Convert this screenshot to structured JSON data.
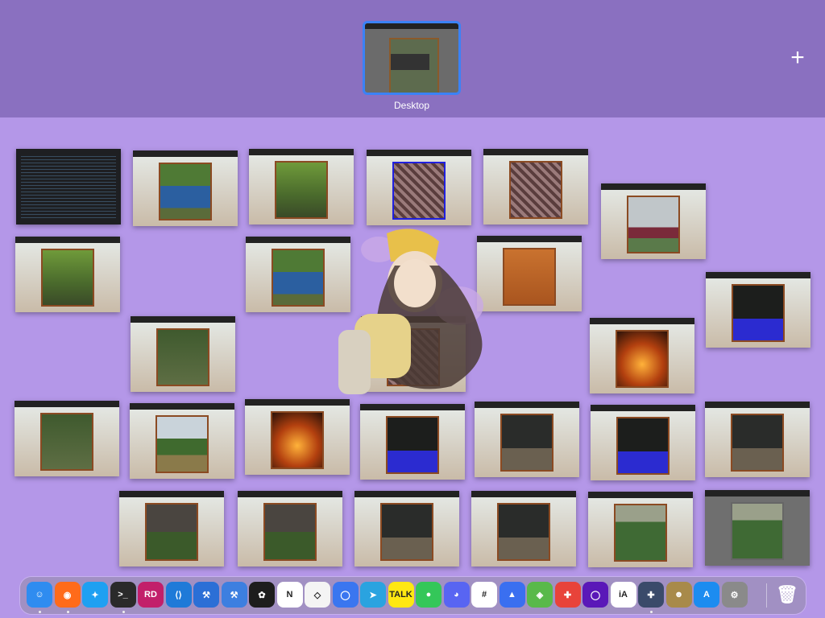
{
  "spaces": {
    "current_label": "Desktop",
    "add_symbol": "+"
  },
  "windows_count": 30,
  "dock": {
    "apps": [
      {
        "name": "Finder",
        "glyph": "☺",
        "color": "#2f8cf0",
        "running": true
      },
      {
        "name": "Firefox",
        "glyph": "◉",
        "color": "#ff6b1a",
        "running": true
      },
      {
        "name": "Safari",
        "glyph": "✦",
        "color": "#1ea0f2",
        "running": false
      },
      {
        "name": "Terminal Goat",
        "glyph": ">_",
        "color": "#2a2a2a",
        "running": true
      },
      {
        "name": "Rider",
        "glyph": "RD",
        "color": "#c21f6a",
        "running": false
      },
      {
        "name": "VS Code",
        "glyph": "⟨⟩",
        "color": "#1f7ad8",
        "running": false
      },
      {
        "name": "Xcode",
        "glyph": "⚒",
        "color": "#2b6fd6",
        "running": false
      },
      {
        "name": "Xcode Beta",
        "glyph": "⚒",
        "color": "#3d7fe0",
        "running": false
      },
      {
        "name": "Figma",
        "glyph": "✿",
        "color": "#1d1d1d",
        "running": false
      },
      {
        "name": "Notion",
        "glyph": "N",
        "color": "#ffffff",
        "running": false
      },
      {
        "name": "Unity",
        "glyph": "◇",
        "color": "#f4f4f4",
        "running": false
      },
      {
        "name": "Signal",
        "glyph": "◯",
        "color": "#3a76f0",
        "running": false
      },
      {
        "name": "Telegram",
        "glyph": "➤",
        "color": "#2aa3e0",
        "running": false
      },
      {
        "name": "KakaoTalk",
        "glyph": "TALK",
        "color": "#ffe812",
        "running": false
      },
      {
        "name": "Messages",
        "glyph": "●",
        "color": "#34c759",
        "running": false
      },
      {
        "name": "Discord",
        "glyph": "◕",
        "color": "#5865f2",
        "running": false
      },
      {
        "name": "Slack",
        "glyph": "#",
        "color": "#ffffff",
        "running": false
      },
      {
        "name": "Arc",
        "glyph": "▲",
        "color": "#3a6ff0",
        "running": false
      },
      {
        "name": "Maps",
        "glyph": "◈",
        "color": "#59b94a",
        "running": false
      },
      {
        "name": "Game",
        "glyph": "✚",
        "color": "#e8433a",
        "running": false
      },
      {
        "name": "Nova",
        "glyph": "◯",
        "color": "#5a18b8",
        "running": false
      },
      {
        "name": "iA Writer",
        "glyph": "iA",
        "color": "#ffffff",
        "running": false
      },
      {
        "name": "Xcode Cloud",
        "glyph": "✚",
        "color": "#3a4a6a",
        "running": true
      },
      {
        "name": "Contacts",
        "glyph": "☻",
        "color": "#a88a4a",
        "running": false
      },
      {
        "name": "App Store",
        "glyph": "A",
        "color": "#1c8cf0",
        "running": false
      },
      {
        "name": "System Settings",
        "glyph": "⚙",
        "color": "#8a8a8a",
        "running": false
      }
    ],
    "trash": {
      "name": "Trash",
      "glyph": "🗑"
    }
  }
}
